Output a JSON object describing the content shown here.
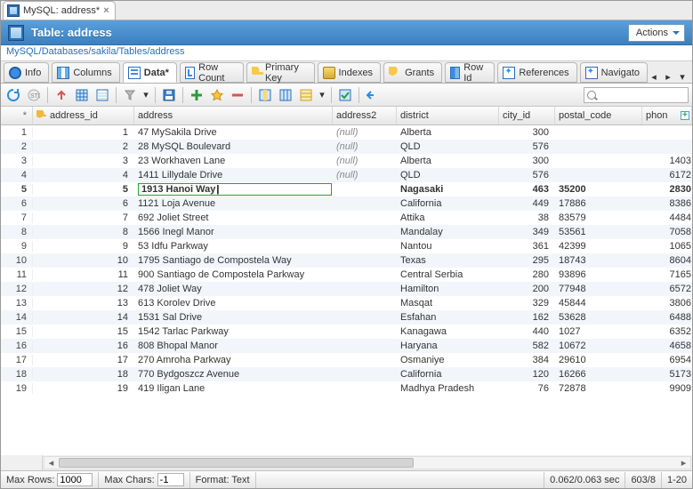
{
  "tab": {
    "title": "MySQL: address*"
  },
  "header": {
    "title": "Table: address",
    "actions": "Actions"
  },
  "breadcrumb": "MySQL/Databases/sakila/Tables/address",
  "ribbon": {
    "items": [
      {
        "label": "Info"
      },
      {
        "label": "Columns"
      },
      {
        "label": "Data*"
      },
      {
        "label": "Row Count"
      },
      {
        "label": "Primary Key"
      },
      {
        "label": "Indexes"
      },
      {
        "label": "Grants"
      },
      {
        "label": "Row Id"
      },
      {
        "label": "References"
      },
      {
        "label": "Navigato"
      }
    ]
  },
  "columns": [
    "address_id",
    "address",
    "address2",
    "district",
    "city_id",
    "postal_code",
    "phon"
  ],
  "rows": [
    {
      "n": 1,
      "aid": 1,
      "addr": "47 MySakila Drive",
      "addr2": "(null)",
      "dist": "Alberta",
      "city": 300,
      "postal": "",
      "phone": ""
    },
    {
      "n": 2,
      "aid": 2,
      "addr": "28 MySQL Boulevard",
      "addr2": "(null)",
      "dist": "QLD",
      "city": 576,
      "postal": "",
      "phone": ""
    },
    {
      "n": 3,
      "aid": 3,
      "addr": "23 Workhaven Lane",
      "addr2": "(null)",
      "dist": "Alberta",
      "city": 300,
      "postal": "",
      "phone": "1403"
    },
    {
      "n": 4,
      "aid": 4,
      "addr": "1411 Lillydale Drive",
      "addr2": "(null)",
      "dist": "QLD",
      "city": 576,
      "postal": "",
      "phone": "6172"
    },
    {
      "n": 5,
      "aid": 5,
      "addr": "1913 Hanoi Way",
      "addr2": "",
      "dist": "Nagasaki",
      "city": 463,
      "postal": "35200",
      "phone": "2830",
      "editing": true
    },
    {
      "n": 6,
      "aid": 6,
      "addr": "1121 Loja Avenue",
      "addr2": "",
      "dist": "California",
      "city": 449,
      "postal": "17886",
      "phone": "8386"
    },
    {
      "n": 7,
      "aid": 7,
      "addr": "692 Joliet Street",
      "addr2": "",
      "dist": "Attika",
      "city": 38,
      "postal": "83579",
      "phone": "4484"
    },
    {
      "n": 8,
      "aid": 8,
      "addr": "1566 Inegl Manor",
      "addr2": "",
      "dist": "Mandalay",
      "city": 349,
      "postal": "53561",
      "phone": "7058"
    },
    {
      "n": 9,
      "aid": 9,
      "addr": "53 Idfu Parkway",
      "addr2": "",
      "dist": "Nantou",
      "city": 361,
      "postal": "42399",
      "phone": "1065"
    },
    {
      "n": 10,
      "aid": 10,
      "addr": "1795 Santiago de Compostela Way",
      "addr2": "",
      "dist": "Texas",
      "city": 295,
      "postal": "18743",
      "phone": "8604"
    },
    {
      "n": 11,
      "aid": 11,
      "addr": "900 Santiago de Compostela Parkway",
      "addr2": "",
      "dist": "Central Serbia",
      "city": 280,
      "postal": "93896",
      "phone": "7165"
    },
    {
      "n": 12,
      "aid": 12,
      "addr": "478 Joliet Way",
      "addr2": "",
      "dist": "Hamilton",
      "city": 200,
      "postal": "77948",
      "phone": "6572"
    },
    {
      "n": 13,
      "aid": 13,
      "addr": "613 Korolev Drive",
      "addr2": "",
      "dist": "Masqat",
      "city": 329,
      "postal": "45844",
      "phone": "3806"
    },
    {
      "n": 14,
      "aid": 14,
      "addr": "1531 Sal Drive",
      "addr2": "",
      "dist": "Esfahan",
      "city": 162,
      "postal": "53628",
      "phone": "6488"
    },
    {
      "n": 15,
      "aid": 15,
      "addr": "1542 Tarlac Parkway",
      "addr2": "",
      "dist": "Kanagawa",
      "city": 440,
      "postal": "1027",
      "phone": "6352"
    },
    {
      "n": 16,
      "aid": 16,
      "addr": "808 Bhopal Manor",
      "addr2": "",
      "dist": "Haryana",
      "city": 582,
      "postal": "10672",
      "phone": "4658"
    },
    {
      "n": 17,
      "aid": 17,
      "addr": "270 Amroha Parkway",
      "addr2": "",
      "dist": "Osmaniye",
      "city": 384,
      "postal": "29610",
      "phone": "6954"
    },
    {
      "n": 18,
      "aid": 18,
      "addr": "770 Bydgoszcz Avenue",
      "addr2": "",
      "dist": "California",
      "city": 120,
      "postal": "16266",
      "phone": "5173"
    },
    {
      "n": 19,
      "aid": 19,
      "addr": "419 Iligan Lane",
      "addr2": "",
      "dist": "Madhya Pradesh",
      "city": 76,
      "postal": "72878",
      "phone": "9909"
    }
  ],
  "status": {
    "max_rows_label": "Max Rows:",
    "max_rows_val": "1000",
    "max_chars_label": "Max Chars:",
    "max_chars_val": "-1",
    "format_label": "Format: Text",
    "timing": "0.062/0.063 sec",
    "pos": "603/8",
    "range": "1-20"
  },
  "search": {
    "placeholder": ""
  }
}
